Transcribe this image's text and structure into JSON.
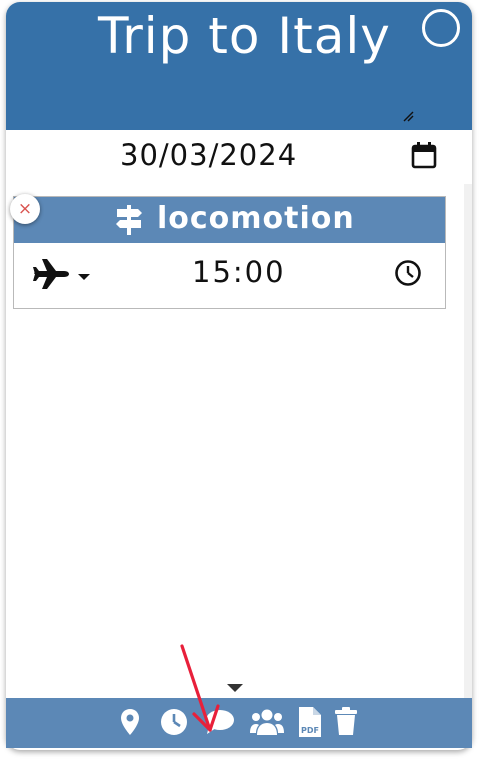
{
  "header": {
    "title": "Trip to Italy"
  },
  "date": {
    "value": "30/03/2024"
  },
  "block": {
    "title": "locomotion",
    "transport_icon": "plane-icon",
    "time": "15:00",
    "remove_label": "×"
  },
  "footer": {
    "buttons": [
      {
        "icon": "map-pin-icon"
      },
      {
        "icon": "clock-icon"
      },
      {
        "icon": "comment-icon"
      },
      {
        "icon": "users-icon"
      },
      {
        "icon": "pdf-icon"
      },
      {
        "icon": "trash-icon"
      }
    ]
  },
  "colors": {
    "header": "#3671a8",
    "block_header": "#5c88b6",
    "footer": "#5c88b6",
    "remove": "#d9534f",
    "annotation_arrow": "#e8203a"
  }
}
